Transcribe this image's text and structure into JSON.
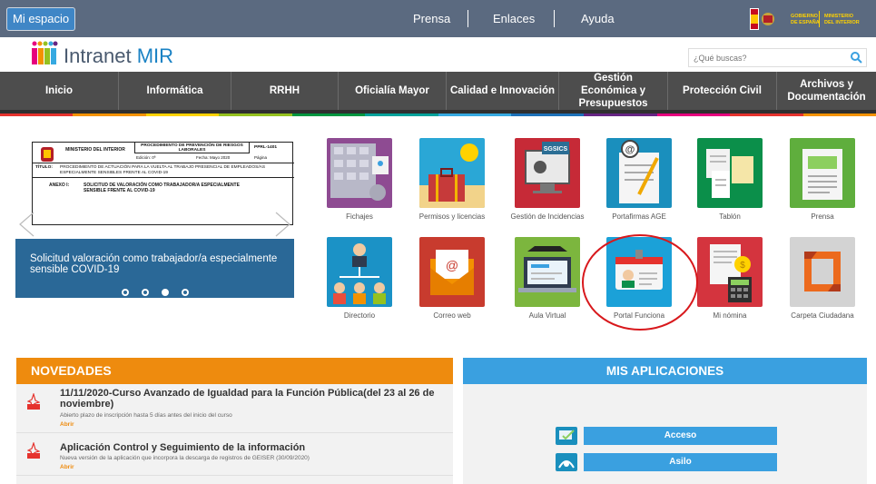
{
  "topbar": {
    "mi_espacio": "Mi espacio",
    "links": [
      "Prensa",
      "Enlaces",
      "Ayuda"
    ],
    "gov_left": "GOBIERNO DE ESPAÑA",
    "gov_right": "MINISTERIO DEL INTERIOR"
  },
  "header": {
    "brand_prefix": "Intranet ",
    "brand_suffix": "MIR",
    "search_placeholder": "¿Qué buscas?"
  },
  "nav": [
    "Inicio",
    "Informática",
    "RRHH",
    "Oficialía Mayor",
    "Calidad e Innovación",
    "Gestión Económica y Presupuestos",
    "Protección Civil",
    "Archivos y Documentación"
  ],
  "stripe_colors": [
    "#e5322d",
    "#f39200",
    "#ffd200",
    "#95c11f",
    "#009640",
    "#00a19a",
    "#36a9e1",
    "#1d71b8",
    "#662483",
    "#e6007e",
    "#e5322d",
    "#f39200"
  ],
  "slider": {
    "doc": {
      "ministry": "MINISTERIO DEL INTERIOR",
      "procedure": "PROCEDIMIENTO DE PREVENCIÓN DE RIESGOS LABORALES",
      "code": "PPRL-1401",
      "edition": "Edición: 0ª",
      "date": "Fecha: Mayo 2020",
      "page": "Página",
      "titulo_label": "TÍTULO:",
      "titulo": "PROCEDIMIENTO DE ACTUACIÓN PARA LA VUELTA AL TRABAJO PRESENCIAL DE EMPLEADOS/AS ESPECIALMENTE SENSIBLES FRENTE AL COVID-19",
      "anexo_label": "ANEXO I:",
      "anexo": "SOLICITUD DE VALORACIÓN COMO TRABAJADOR/A ESPECIALMENTE SENSIBLE FRENTE AL COVID-19"
    },
    "caption": "Solicitud valoración como trabajador/a especialmente sensible COVID-19",
    "active_dot": 3
  },
  "apps": [
    {
      "label": "Fichajes",
      "color": "#8e4b92"
    },
    {
      "label": "Permisos y licencias",
      "color": "#2aa7d6"
    },
    {
      "label": "Gestión de Incidencias",
      "color": "#c62a37",
      "badge": "SGSICS"
    },
    {
      "label": "Portafirmas AGE",
      "color": "#1a8fbd"
    },
    {
      "label": "Tablón",
      "color": "#0b8f4a"
    },
    {
      "label": "Prensa",
      "color": "#5fae3d"
    },
    {
      "label": "Directorio",
      "color": "#1b92c6"
    },
    {
      "label": "Correo web",
      "color": "#c83b2e",
      "glyph": "@"
    },
    {
      "label": "Aula Virtual",
      "color": "#7cb63e"
    },
    {
      "label": "Portal Funciona",
      "color": "#1ba1d8"
    },
    {
      "label": "Mi nómina",
      "color": "#d4343e"
    },
    {
      "label": "Carpeta Ciudadana",
      "color": "#d3d3d3"
    }
  ],
  "novedades": {
    "title": "NOVEDADES",
    "items": [
      {
        "title": "11/11/2020-Curso Avanzado de Igualdad para la Función Pública(del 23 al 26 de noviembre)",
        "desc": "Abierto plazo de inscripción hasta 5 días antes del inicio del curso",
        "link": "Abrir"
      },
      {
        "title": "Aplicación Control y Seguimiento de la información",
        "desc": "Nueva versión de la aplicación que incorpora la descarga de registros de GEISER (30/09/2020)",
        "link": "Abrir"
      }
    ]
  },
  "mis_aplicaciones": {
    "title": "MIS APLICACIONES",
    "items": [
      "Acceso",
      "Asilo"
    ]
  }
}
